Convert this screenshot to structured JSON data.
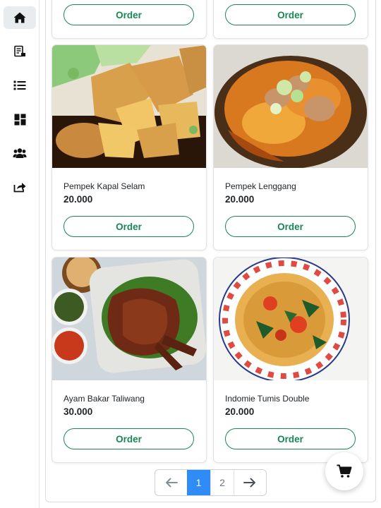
{
  "sidebar": {
    "items": [
      {
        "icon": "home-icon",
        "active": true
      },
      {
        "icon": "receipt-icon",
        "active": false
      },
      {
        "icon": "list-icon",
        "active": false
      },
      {
        "icon": "dashboard-icon",
        "active": false
      },
      {
        "icon": "users-icon",
        "active": false
      },
      {
        "icon": "share-icon",
        "active": false
      }
    ]
  },
  "products": [
    {
      "name": "",
      "price": "",
      "order_label": "Order"
    },
    {
      "name": "",
      "price": "",
      "order_label": "Order"
    },
    {
      "name": "Pempek Kapal Selam",
      "price": "20.000",
      "order_label": "Order"
    },
    {
      "name": "Pempek Lenggang",
      "price": "20.000",
      "order_label": "Order"
    },
    {
      "name": "Ayam Bakar Taliwang",
      "price": "30.000",
      "order_label": "Order"
    },
    {
      "name": "Indomie Tumis Double",
      "price": "20.000",
      "order_label": "Order"
    }
  ],
  "pagination": {
    "prev_icon": "arrow-left-icon",
    "pages": [
      "1",
      "2"
    ],
    "current": "1",
    "next_icon": "arrow-right-icon"
  },
  "cart": {
    "icon": "cart-icon"
  },
  "colors": {
    "accent_green": "#198754",
    "page_active": "#2f8cf7"
  }
}
